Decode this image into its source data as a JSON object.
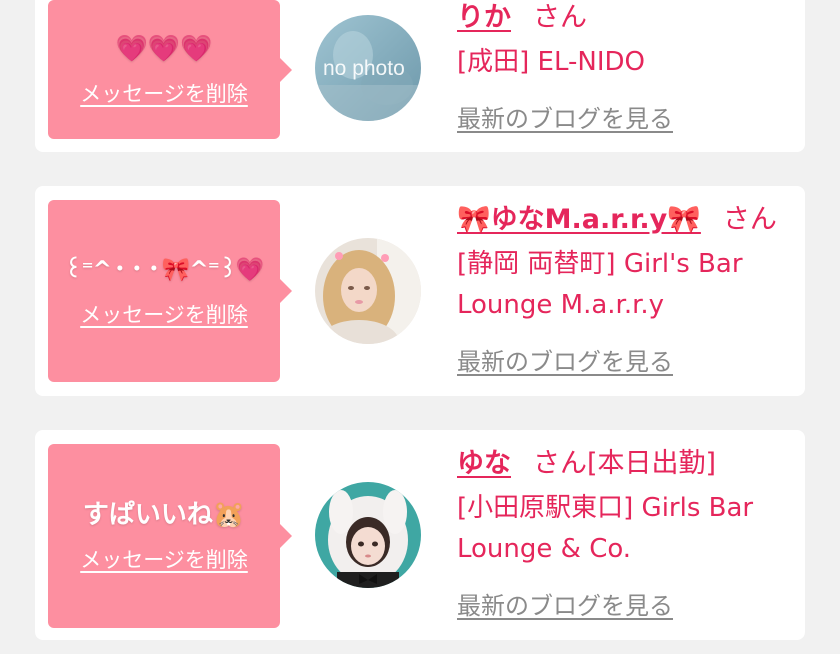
{
  "cards": [
    {
      "message": "💗💗💗",
      "delete_label": "メッセージを削除",
      "avatar": "no-photo-avatar",
      "avatar_text": "no photo",
      "name": "りか",
      "honorific": "さん",
      "status": "",
      "shop": "[成田] EL-NIDO",
      "blog_label": "最新のブログを見る"
    },
    {
      "message": "꒰⁼^・・・🎀^⁼꒱💗",
      "delete_label": "メッセージを削除",
      "avatar": "blonde-woman-avatar",
      "name": "🎀ゆなM.a.r.r.y🎀",
      "honorific": "さん",
      "status": "",
      "shop": "[静岡 両替町] Girl's Bar Lounge M.a.r.r.y",
      "blog_label": "最新のブログを見る"
    },
    {
      "message": "すぱいいね🐹",
      "delete_label": "メッセージを削除",
      "avatar": "bunny-hood-woman-avatar",
      "name": "ゆな",
      "honorific": "さん",
      "status": "[本日出勤]",
      "shop": "[小田原駅東口] Girls Bar Lounge & Co.",
      "blog_label": "最新のブログを見る"
    }
  ],
  "colors": {
    "accent": "#e5265b",
    "bubble": "#fd8fa0",
    "muted": "#8a8a8a",
    "background": "#f1f1f1"
  }
}
